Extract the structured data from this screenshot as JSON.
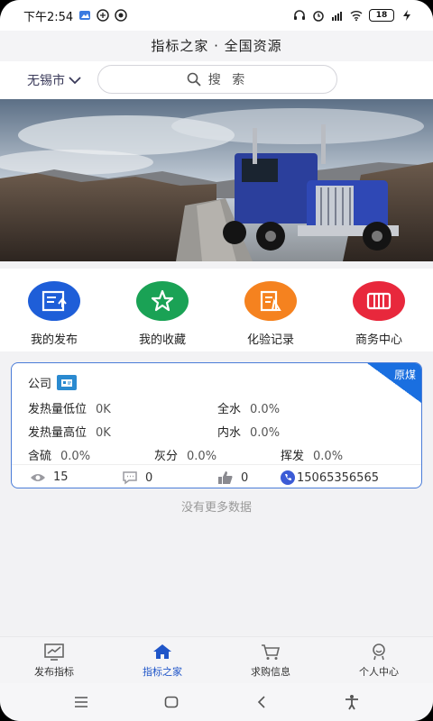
{
  "status_bar": {
    "time": "下午2:54",
    "battery": "18"
  },
  "header": {
    "title": "指标之家 · 全国资源"
  },
  "search": {
    "city": "无锡市",
    "placeholder": "搜 索"
  },
  "quick_actions": [
    {
      "label": "我的发布",
      "icon": "publish-icon",
      "color": "#1e5ed8"
    },
    {
      "label": "我的收藏",
      "icon": "star-icon",
      "color": "#1aa255"
    },
    {
      "label": "化验记录",
      "icon": "lab-record-icon",
      "color": "#f5821f"
    },
    {
      "label": "商务中心",
      "icon": "business-icon",
      "color": "#e8283c"
    }
  ],
  "card": {
    "corner_label": "原煤",
    "company": "公司",
    "rows": [
      {
        "label": "发热量低位",
        "value": "0K"
      },
      {
        "label": "全水",
        "value": "0.0%"
      },
      {
        "label": "发热量高位",
        "value": "0K"
      },
      {
        "label": "内水",
        "value": "0.0%"
      },
      {
        "label": "含硫",
        "value": "0.0%"
      },
      {
        "label": "灰分",
        "value": "0.0%"
      },
      {
        "label": "挥发",
        "value": "0.0%"
      }
    ],
    "stats": {
      "views": "15",
      "comments": "0",
      "likes": "0",
      "phone": "15065356565"
    }
  },
  "list_footer": "没有更多数据",
  "bottom_nav": [
    {
      "label": "发布指标",
      "icon": "chart-icon"
    },
    {
      "label": "指标之家",
      "icon": "home-icon"
    },
    {
      "label": "求购信息",
      "icon": "cart-icon"
    },
    {
      "label": "个人中心",
      "icon": "user-icon"
    }
  ],
  "colors": {
    "accent": "#1f55c8",
    "card_border": "#4a7cd8"
  }
}
